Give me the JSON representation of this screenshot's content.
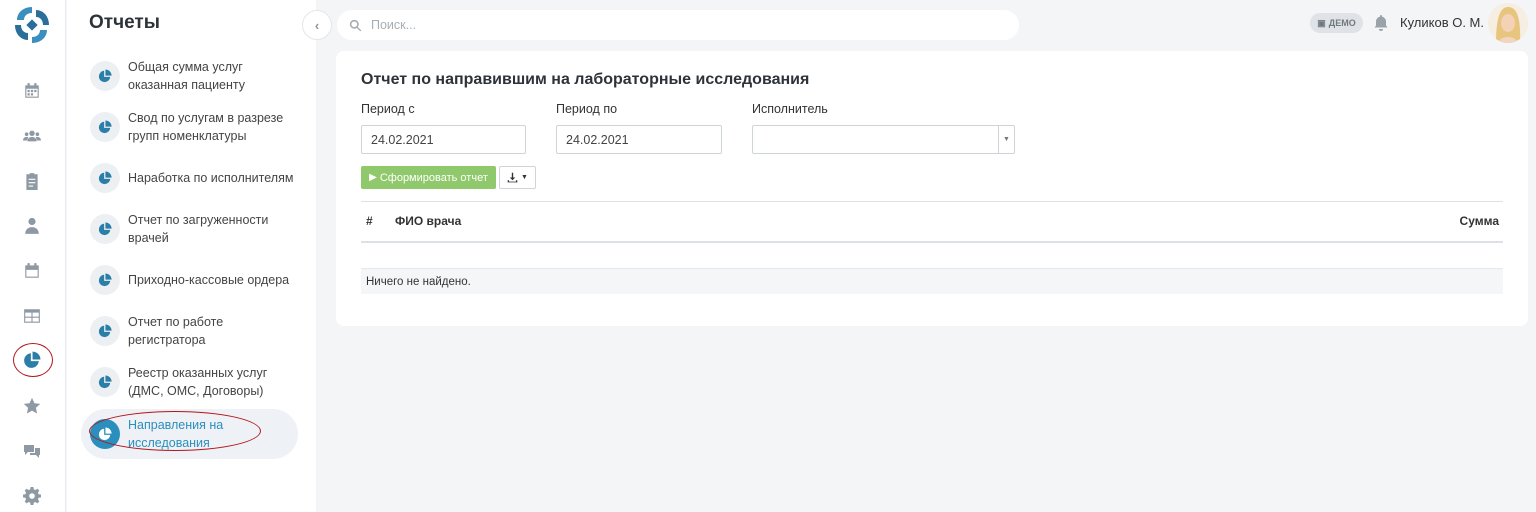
{
  "search": {
    "placeholder": "Поиск..."
  },
  "header": {
    "demo_badge": "ДЕМО",
    "user_name": "Куликов О. М."
  },
  "nav_rail": {
    "icons": [
      "calendar-icon",
      "users-icon",
      "clipboard-icon",
      "doctor-icon",
      "schedule-icon",
      "table-icon",
      "pie-chart-icon",
      "star-icon",
      "chat-icon",
      "settings-icon"
    ],
    "active": "pie-chart-icon"
  },
  "reports_panel": {
    "title": "Отчеты",
    "items": [
      {
        "label": "Общая сумма услуг оказанная пациенту"
      },
      {
        "label": "Свод по услугам в разрезе групп номенклатуры"
      },
      {
        "label": "Наработка по исполнителям"
      },
      {
        "label": "Отчет по загруженности врачей"
      },
      {
        "label": "Приходно-кассовые ордера"
      },
      {
        "label": "Отчет по работе регистратора"
      },
      {
        "label": "Реестр оказанных услуг (ДМС, ОМС, Договоры)"
      },
      {
        "label": "Направления на исследования"
      }
    ],
    "active_index": 7
  },
  "report": {
    "title": "Отчет по направившим на лабораторные исследования",
    "period_from_label": "Период с",
    "period_from_value": "24.02.2021",
    "period_to_label": "Период по",
    "period_to_value": "24.02.2021",
    "executor_label": "Исполнитель",
    "executor_value": "",
    "generate_button": "Сформировать отчет",
    "table": {
      "columns": [
        "#",
        "ФИО врача",
        "Сумма"
      ],
      "empty_text": "Ничего не найдено."
    }
  },
  "colors": {
    "accent": "#2b8fbd",
    "generate_button": "#8fc96b",
    "highlight_annotation": "#b5161c"
  }
}
